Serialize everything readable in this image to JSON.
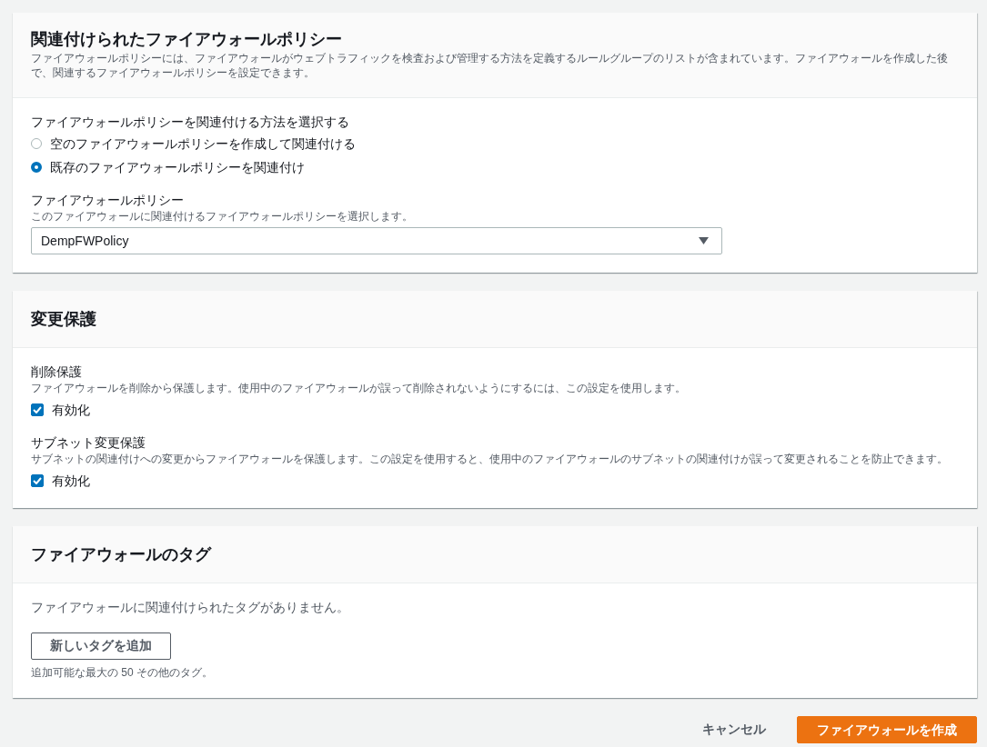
{
  "policy_panel": {
    "title": "関連付けられたファイアウォールポリシー",
    "description": "ファイアウォールポリシーには、ファイアウォールがウェブトラフィックを検査および管理する方法を定義するルールグループのリストが含まれています。ファイアウォールを作成した後で、関連するファイアウォールポリシーを設定できます。",
    "method_label": "ファイアウォールポリシーを関連付ける方法を選択する",
    "options": [
      {
        "label": "空のファイアウォールポリシーを作成して関連付ける",
        "selected": false
      },
      {
        "label": "既存のファイアウォールポリシーを関連付け",
        "selected": true
      }
    ],
    "policy_field": {
      "label": "ファイアウォールポリシー",
      "hint": "このファイアウォールに関連付けるファイアウォールポリシーを選択します。",
      "value": "DempFWPolicy"
    }
  },
  "protection_panel": {
    "title": "変更保護",
    "settings": [
      {
        "label": "削除保護",
        "description": "ファイアウォールを削除から保護します。使用中のファイアウォールが誤って削除されないようにするには、この設定を使用します。",
        "checkbox_label": "有効化",
        "checked": true
      },
      {
        "label": "サブネット変更保護",
        "description": "サブネットの関連付けへの変更からファイアウォールを保護します。この設定を使用すると、使用中のファイアウォールのサブネットの関連付けが誤って変更されることを防止できます。",
        "checkbox_label": "有効化",
        "checked": true
      }
    ]
  },
  "tags_panel": {
    "title": "ファイアウォールのタグ",
    "empty_message": "ファイアウォールに関連付けられたタグがありません。",
    "add_button": "新しいタグを追加",
    "limit_note": "追加可能な最大の 50 その他のタグ。"
  },
  "actions": {
    "cancel": "キャンセル",
    "create": "ファイアウォールを作成"
  }
}
